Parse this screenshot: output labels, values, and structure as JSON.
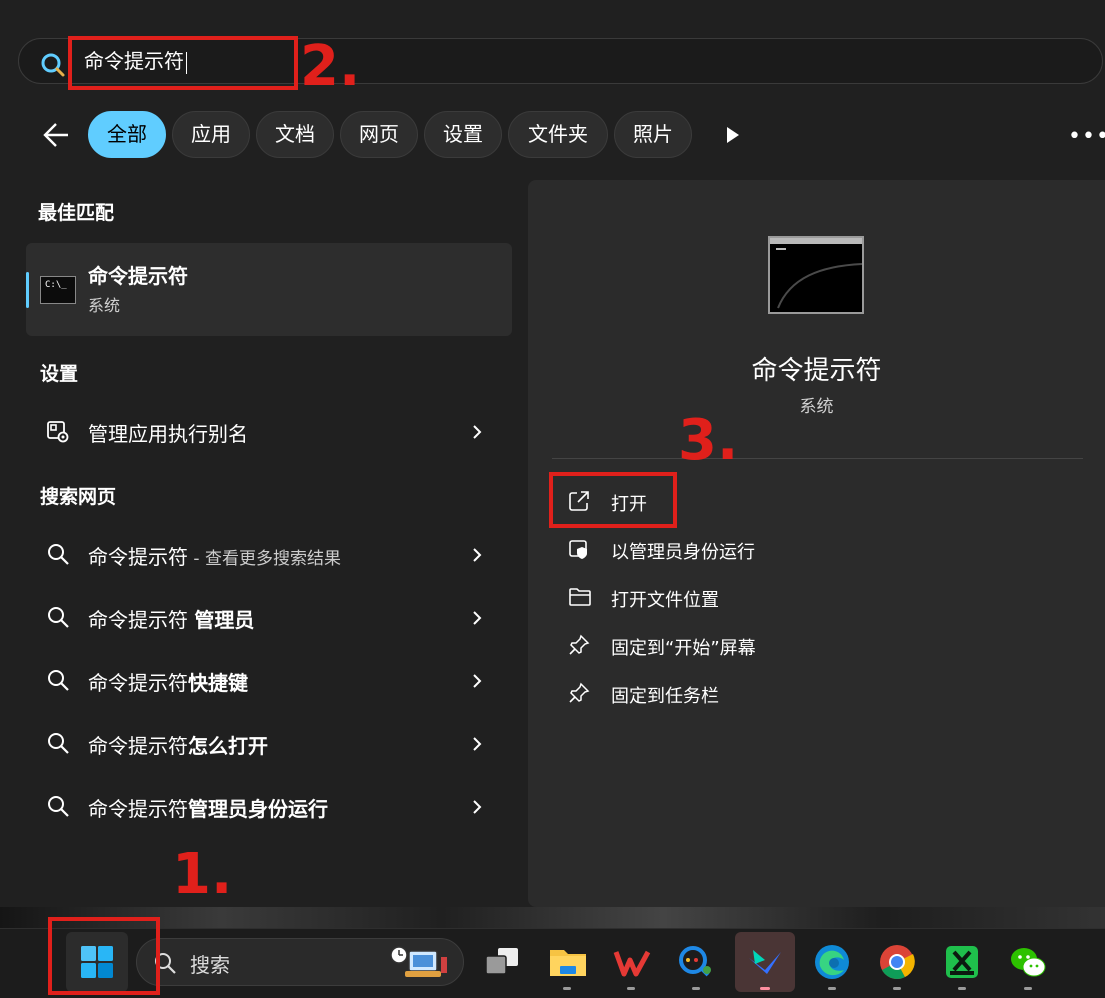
{
  "search": {
    "query": "命令提示符"
  },
  "filters": {
    "tabs": [
      {
        "label": "全部",
        "active": true
      },
      {
        "label": "应用"
      },
      {
        "label": "文档"
      },
      {
        "label": "网页"
      },
      {
        "label": "设置"
      },
      {
        "label": "文件夹"
      },
      {
        "label": "照片"
      }
    ]
  },
  "best_match": {
    "section_title": "最佳匹配",
    "name": "命令提示符",
    "category": "系统",
    "icon": "cmd-icon",
    "icon_text": "C:\\_"
  },
  "settings": {
    "section_title": "设置",
    "items": [
      {
        "label": "管理应用执行别名",
        "icon": "app-alias-settings-icon"
      }
    ]
  },
  "web": {
    "section_title": "搜索网页",
    "items": [
      {
        "prefix": "命令提示符",
        "suffix": " - 查看更多搜索结果",
        "suffix_style": "muted"
      },
      {
        "prefix": "命令提示符 ",
        "suffix": "管理员",
        "suffix_style": "bold"
      },
      {
        "prefix": "命令提示符",
        "suffix": "快捷键",
        "suffix_style": "bold"
      },
      {
        "prefix": "命令提示符",
        "suffix": "怎么打开",
        "suffix_style": "bold"
      },
      {
        "prefix": "命令提示符",
        "suffix": "管理员身份运行",
        "suffix_style": "bold"
      }
    ]
  },
  "detail": {
    "title": "命令提示符",
    "subtitle": "系统",
    "actions": [
      {
        "label": "打开",
        "icon": "open-external-icon"
      },
      {
        "label": "以管理员身份运行",
        "icon": "shield-icon"
      },
      {
        "label": "打开文件位置",
        "icon": "folder-icon"
      },
      {
        "label": "固定到“开始”屏幕",
        "icon": "pin-icon"
      },
      {
        "label": "固定到任务栏",
        "icon": "pin-icon"
      }
    ]
  },
  "taskbar": {
    "search_label": "搜索",
    "apps": [
      "task-view-icon",
      "file-explorer-icon",
      "wps-icon",
      "lark-search-icon",
      "feishu-icon",
      "edge-icon",
      "chrome-icon",
      "xtool-icon",
      "wechat-icon"
    ]
  },
  "annotations": {
    "step1": "1.",
    "step2": "2.",
    "step3": "3."
  },
  "colors": {
    "accent": "#60cdff",
    "annotation_red": "#e0201b",
    "background": "#202020"
  }
}
